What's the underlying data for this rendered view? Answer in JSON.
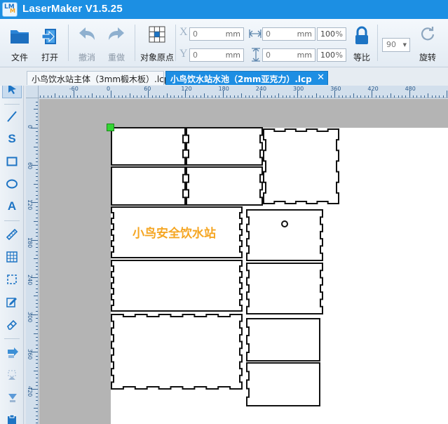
{
  "app": {
    "title": "LaserMaker V1.5.25",
    "logo_text": "LM",
    "logo_sub": "M"
  },
  "toolbar": {
    "file_label": "文件",
    "open_label": "打开",
    "undo_label": "撤消",
    "redo_label": "重做",
    "origin_label": "对象原点",
    "lock_ratio_label": "等比",
    "rotate_label": "旋转",
    "x_label": "X",
    "y_label": "Y",
    "x_value": "0",
    "y_value": "0",
    "x_unit": "mm",
    "y_unit": "mm",
    "width_value": "0",
    "height_value": "0",
    "width_unit": "mm",
    "height_unit": "mm",
    "width_percent": "100",
    "height_percent": "100",
    "percent_sign": "%",
    "rotate_value": "90",
    "rotate_dropdown": "▼"
  },
  "tabs": [
    {
      "label": "小鸟饮水站主体（3mm椴木板）.lcp"
    },
    {
      "label": "小鸟饮水站水池（2mm亚克力）.lcp",
      "close": "✕"
    }
  ],
  "tools": [
    {
      "name": "select"
    },
    {
      "name": "line"
    },
    {
      "name": "curve",
      "glyph": "S"
    },
    {
      "name": "rectangle"
    },
    {
      "name": "ellipse"
    },
    {
      "name": "text",
      "glyph": "A"
    },
    {
      "name": "ruler"
    },
    {
      "name": "array"
    },
    {
      "name": "crop"
    },
    {
      "name": "edit"
    },
    {
      "name": "eraser"
    },
    {
      "name": "import"
    },
    {
      "name": "align"
    },
    {
      "name": "export"
    }
  ],
  "ruler": {
    "h_labels": [
      "-60",
      "0",
      "60",
      "120",
      "180",
      "240",
      "300",
      "360",
      "420",
      "480"
    ],
    "v_labels": [
      "0",
      "60",
      "120",
      "180",
      "240",
      "300",
      "360",
      "420"
    ]
  },
  "design": {
    "engrave_text": "小鸟安全饮水站"
  },
  "colors": {
    "title_bar": "#1c8fe3",
    "active_tab": "#1d8ee3",
    "accent_blue": "#1d74c4",
    "engrave_orange": "#f5a623",
    "origin_green": "#33d633"
  }
}
